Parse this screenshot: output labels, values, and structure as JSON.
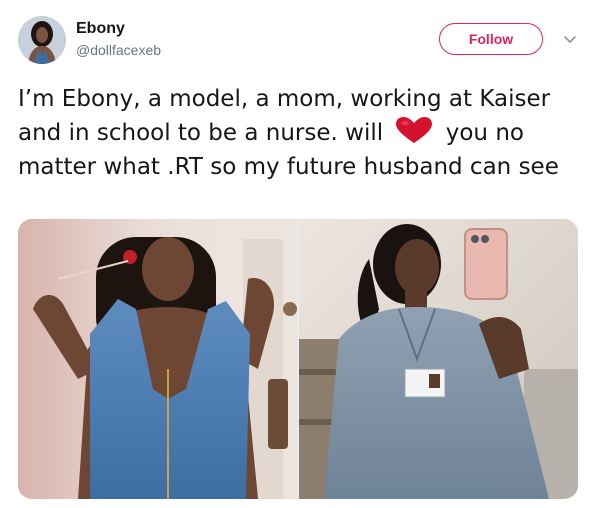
{
  "tweet": {
    "display_name": "Ebony",
    "handle": "@dollfacexeb",
    "follow_label": "Follow",
    "text_before_emoji": "I’m Ebony, a model, a mom, working at Kaiser and in school to be a nurse. will ",
    "emoji": "heart-emoji",
    "text_after_emoji": " you no matter what .RT so my future husband can see"
  },
  "icons": {
    "more": "chevron-down-icon",
    "heart": "heart-emoji"
  },
  "colors": {
    "follow_accent": "#e0245e",
    "heart": "#d4122e",
    "secondary_text": "#657786",
    "primary_text": "#14171a"
  },
  "media": {
    "count": 2
  }
}
